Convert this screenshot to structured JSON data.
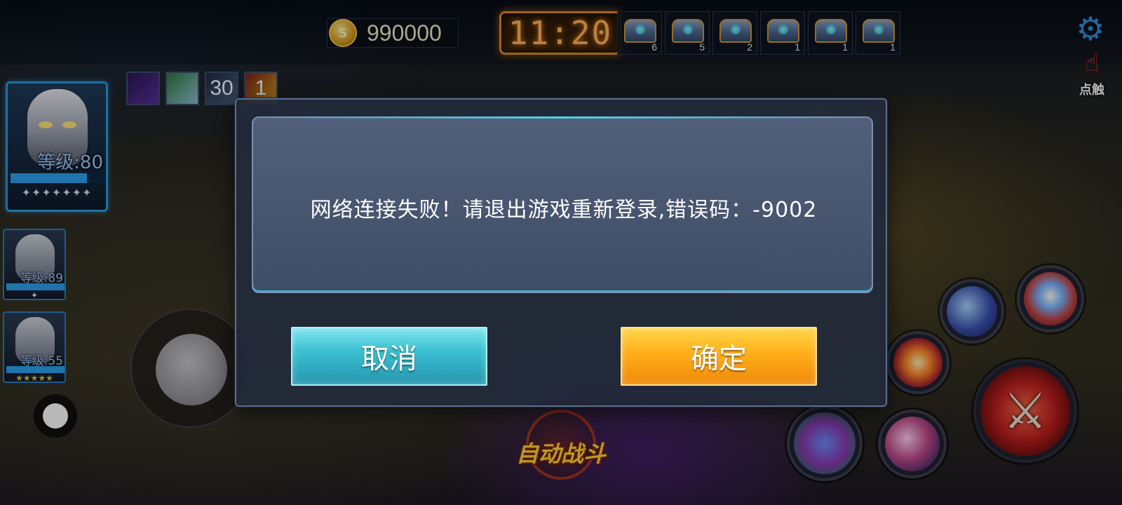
{
  "hud": {
    "coins": "990000",
    "coin_symbol": "S",
    "timer": "11:20",
    "chests": [
      {
        "count": "6"
      },
      {
        "count": "5"
      },
      {
        "count": "2"
      },
      {
        "count": "1"
      },
      {
        "count": "1"
      },
      {
        "count": "1"
      }
    ],
    "touch_label": "点触"
  },
  "buffs": [
    {
      "text": ""
    },
    {
      "text": ""
    },
    {
      "text": "30"
    },
    {
      "text": "1"
    }
  ],
  "heroes": {
    "main": {
      "level": "等级:80",
      "stars": "✦✦✦✦✦✦✦",
      "hp_fraction": 0.8
    },
    "second": {
      "level": "等级:89",
      "stars": "✦",
      "hp_fraction": 1.0
    },
    "third": {
      "level": "等级:55",
      "stars": "★★★★★",
      "hp_fraction": 1.0
    }
  },
  "controls": {
    "auto_battle": "自动战斗"
  },
  "dialog": {
    "message": "网络连接失败！请退出游戏重新登录,错误码：-9002",
    "cancel_label": "取消",
    "confirm_label": "确定"
  },
  "colors": {
    "cancel_button": "#3cc0d2",
    "confirm_button": "#ffae1a",
    "timer": "#ffb35a",
    "hero_frame": "#2a9be0"
  },
  "icons": [
    "coin-icon",
    "chest-icon",
    "settings-icon",
    "touch-icon",
    "crossed-swords-icon"
  ]
}
